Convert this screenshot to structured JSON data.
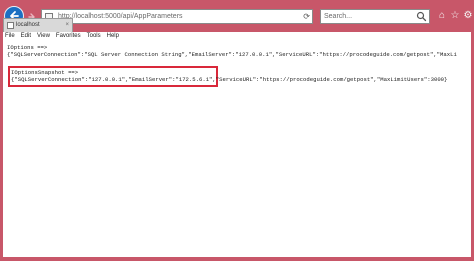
{
  "browser": {
    "address_url": "http://localhost:5000/api/AppParameters",
    "search_placeholder": "Search...",
    "tab_title": "localhost",
    "tab_close": "×"
  },
  "menu": [
    {
      "label": "File"
    },
    {
      "label": "Edit"
    },
    {
      "label": "View"
    },
    {
      "label": "Favorites"
    },
    {
      "label": "Tools"
    },
    {
      "label": "Help"
    }
  ],
  "content": {
    "ioptions_heading": "IOptions ==>",
    "ioptions_json": "{\"SQLServerConnection\":\"SQL Server Connection String\",\"EmailServer\":\"127.0.0.1\",\"ServiceURL\":\"https://procodeguide.com/getpost\",\"MaxLi",
    "snapshot_heading": "IOptionsSnapshot ==>",
    "snapshot_json": "{\"SQLServerConnection\":\"127.0.0.1\",\"EmailServer\":\"172.5.6.1\",\"ServiceURL\":\"https://procodeguide.com/getpost\",\"MaxLimitUsers\":3000}"
  },
  "colors": {
    "frame": "#c85769",
    "highlight_border": "#d9283a",
    "back_button": "#1c6fc2"
  }
}
